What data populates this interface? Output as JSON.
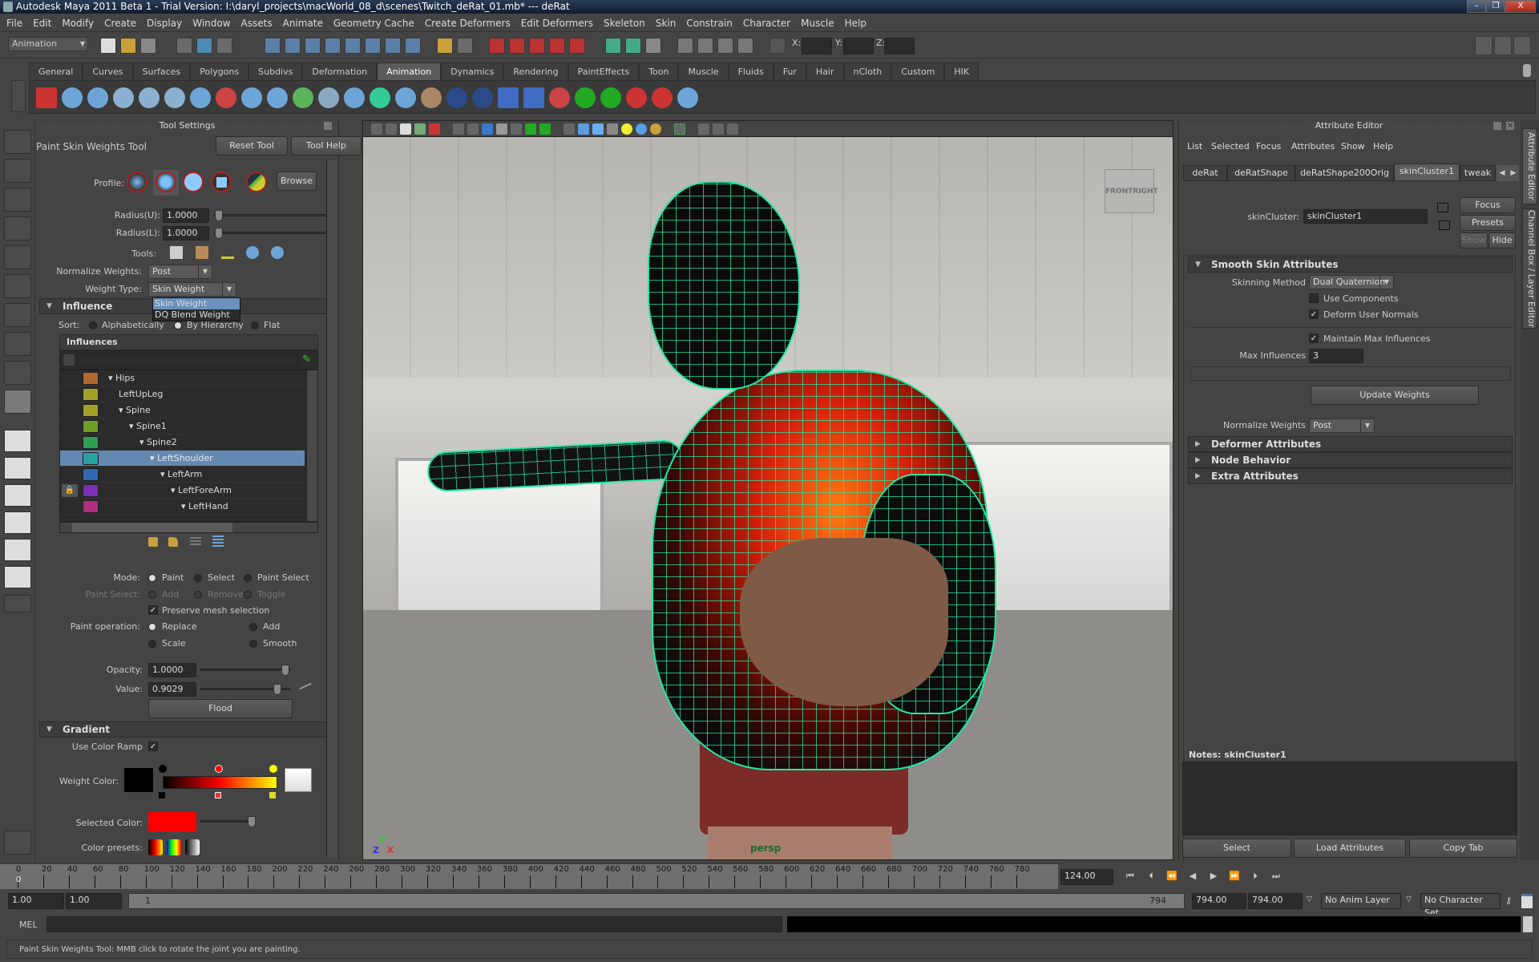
{
  "window": {
    "title": "Autodesk Maya 2011 Beta 1 - Trial Version: I:\\daryl_projects\\macWorld_08_d\\scenes\\Twitch_deRat_01.mb*   ---   deRat",
    "buttons": {
      "minimize": "–",
      "restore": "❐",
      "close": "X"
    }
  },
  "menubar": [
    "File",
    "Edit",
    "Modify",
    "Create",
    "Display",
    "Window",
    "Assets",
    "Animate",
    "Geometry Cache",
    "Create Deformers",
    "Edit Deformers",
    "Skeleton",
    "Skin",
    "Constrain",
    "Character",
    "Muscle",
    "Help"
  ],
  "statusline": {
    "mode": "Animation",
    "x_label": "X:",
    "y_label": "Y:",
    "z_label": "Z:",
    "x_value": "",
    "y_value": "",
    "z_value": ""
  },
  "shelf": {
    "tabs": [
      "General",
      "Curves",
      "Surfaces",
      "Polygons",
      "Subdivs",
      "Deformation",
      "Animation",
      "Dynamics",
      "Rendering",
      "PaintEffects",
      "Toon",
      "Muscle",
      "Fluids",
      "Fur",
      "Hair",
      "nCloth",
      "Custom",
      "HIK"
    ],
    "active_tab": "Animation"
  },
  "tool_settings": {
    "header": "Tool Settings",
    "tool_name": "Paint Skin Weights Tool",
    "reset_tool": "Reset Tool",
    "tool_help": "Tool Help",
    "profile_label": "Profile:",
    "browse": "Browse",
    "radius_u_label": "Radius(U):",
    "radius_u": "1.0000",
    "radius_l_label": "Radius(L):",
    "radius_l": "1.0000",
    "tools_label": "Tools:",
    "normalize_label": "Normalize Weights:",
    "normalize_value": "Post",
    "weight_type_label": "Weight Type:",
    "weight_type_value": "Skin Weight",
    "weight_type_options": [
      "Skin Weight",
      "DQ Blend Weight"
    ],
    "influence_section": "Influence",
    "sort_label": "Sort:",
    "sort_options": [
      "Alphabetically",
      "By Hierarchy",
      "Flat"
    ],
    "sort_selected": "By Hierarchy",
    "influences_header": "Influences",
    "influences_filter": "",
    "influences": [
      {
        "name": "Hips",
        "color": "#b06a2f",
        "level": 0,
        "expanded": true,
        "locked": false,
        "selected": false
      },
      {
        "name": "LeftUpLeg",
        "color": "#a3a02a",
        "level": 1,
        "expanded": false,
        "locked": false,
        "selected": false
      },
      {
        "name": "Spine",
        "color": "#a3a02a",
        "level": 1,
        "expanded": true,
        "locked": false,
        "selected": false
      },
      {
        "name": "Spine1",
        "color": "#6e9e2a",
        "level": 2,
        "expanded": true,
        "locked": false,
        "selected": false
      },
      {
        "name": "Spine2",
        "color": "#2f9e55",
        "level": 3,
        "expanded": true,
        "locked": false,
        "selected": false
      },
      {
        "name": "LeftShoulder",
        "color": "#2aa2a0",
        "level": 4,
        "expanded": true,
        "locked": false,
        "selected": true
      },
      {
        "name": "LeftArm",
        "color": "#2f6ab0",
        "level": 5,
        "expanded": true,
        "locked": false,
        "selected": false
      },
      {
        "name": "LeftForeArm",
        "color": "#7a2fb5",
        "level": 6,
        "expanded": true,
        "locked": true,
        "selected": false
      },
      {
        "name": "LeftHand",
        "color": "#b02f80",
        "level": 7,
        "expanded": true,
        "locked": false,
        "selected": false
      }
    ],
    "mode_label": "Mode:",
    "mode_options": [
      "Paint",
      "Select",
      "Paint Select"
    ],
    "mode_selected": "Paint",
    "paint_select_label": "Paint Select:",
    "paint_select_options": [
      "Add",
      "Remove",
      "Toggle"
    ],
    "preserve_mesh_selection": {
      "label": "Preserve mesh selection",
      "checked": true
    },
    "paint_operation_label": "Paint operation:",
    "paint_operation_options": [
      "Replace",
      "Add",
      "Scale",
      "Smooth"
    ],
    "paint_operation_selected": "Replace",
    "opacity_label": "Opacity:",
    "opacity": "1.0000",
    "opacity_slider": 1.0,
    "value_label": "Value:",
    "value": "0.9029",
    "value_slider": 0.9029,
    "flood": "Flood",
    "gradient_section": "Gradient",
    "use_color_ramp": {
      "label": "Use Color Ramp",
      "checked": true
    },
    "weight_color_label": "Weight Color:",
    "ramp_colors": [
      "#000000",
      "#ff0000",
      "#ffff00"
    ],
    "selected_color_label": "Selected Color:",
    "selected_color": "#ff0000",
    "color_presets_label": "Color presets:"
  },
  "viewport": {
    "camera": "persp",
    "viewcube": {
      "front": "FRONT",
      "right": "RIGHT"
    },
    "axis": {
      "x": "X",
      "y": "Y",
      "z": "Z"
    }
  },
  "attribute_editor": {
    "header": "Attribute Editor",
    "menu": [
      "List",
      "Selected",
      "Focus",
      "Attributes",
      "Show",
      "Help"
    ],
    "tabs": [
      "deRat",
      "deRatShape",
      "deRatShape200Orig",
      "skinCluster1",
      "tweak"
    ],
    "active_tab": "skinCluster1",
    "node_label": "skinCluster:",
    "node_name": "skinCluster1",
    "focus": "Focus",
    "presets": "Presets",
    "show": "Show",
    "hide": "Hide",
    "smooth_skin_section": "Smooth Skin Attributes",
    "skinning_method_label": "Skinning Method",
    "skinning_method": "Dual Quaternion",
    "use_components": {
      "label": "Use Components",
      "checked": false
    },
    "deform_user_normals": {
      "label": "Deform User Normals",
      "checked": true
    },
    "maintain_max_influences": {
      "label": "Maintain Max Influences",
      "checked": true
    },
    "max_influences_label": "Max Influences",
    "max_influences": "3",
    "update_weights": "Update Weights",
    "normalize_weights_label": "Normalize Weights",
    "normalize_weights": "Post",
    "collapsed_sections": [
      "Deformer Attributes",
      "Node Behavior",
      "Extra Attributes"
    ],
    "notes_label": "Notes:  skinCluster1",
    "notes": "",
    "select": "Select",
    "load_attributes": "Load Attributes",
    "copy_tab": "Copy Tab"
  },
  "side_tabs": [
    "Attribute Editor",
    "Channel Box / Layer Editor"
  ],
  "timeline": {
    "ticks": [
      0,
      20,
      40,
      60,
      80,
      100,
      120,
      140,
      160,
      180,
      200,
      220,
      240,
      260,
      280,
      300,
      320,
      340,
      360,
      380,
      400,
      420,
      440,
      460,
      480,
      500,
      520,
      540,
      560,
      580,
      600,
      620,
      640,
      660,
      680,
      700,
      720,
      740,
      760,
      780
    ],
    "min": 0,
    "max": 794,
    "current_marker": "0",
    "current_frame": "124.00"
  },
  "range": {
    "start": "1.00",
    "playback_start": "1.00",
    "slider_start": "1",
    "slider_end": "794",
    "playback_end": "794.00",
    "end": "794.00",
    "anim_layer": "No Anim Layer",
    "character_set": "No Character Set"
  },
  "command_line": {
    "label": "MEL",
    "input": "",
    "result": ""
  },
  "help_line": "Paint Skin Weights Tool: MMB click to rotate the joint you are painting."
}
